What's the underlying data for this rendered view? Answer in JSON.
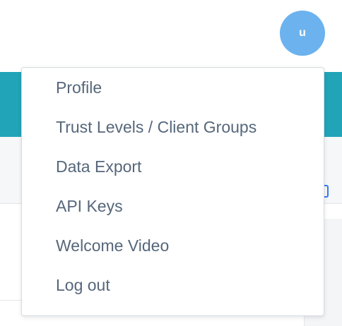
{
  "user": {
    "avatar_initial": "u"
  },
  "menu": {
    "items": [
      {
        "label": "Profile"
      },
      {
        "label": "Trust Levels / Client Groups"
      },
      {
        "label": "Data Export"
      },
      {
        "label": "API Keys"
      },
      {
        "label": "Welcome Video"
      },
      {
        "label": "Log out"
      }
    ]
  },
  "colors": {
    "accent_teal": "#21a4b8",
    "avatar_bg": "#6cb2ee",
    "menu_text": "#56677a"
  }
}
